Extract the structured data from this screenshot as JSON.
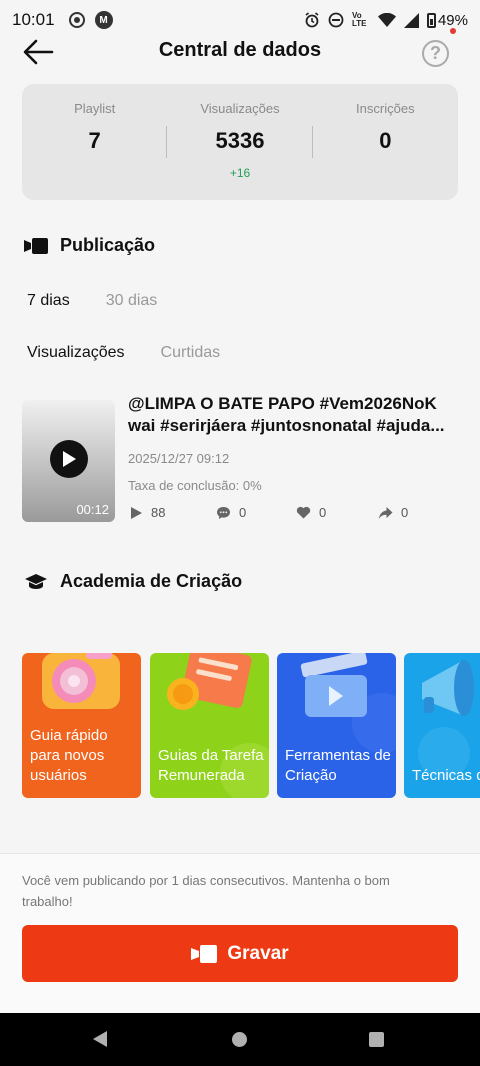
{
  "status_bar": {
    "time": "10:01",
    "battery": "49%",
    "network": "Vo LTE"
  },
  "header": {
    "title": "Central de dados",
    "help_symbol": "?"
  },
  "stats": [
    {
      "label": "Playlist",
      "value": "7",
      "delta": ""
    },
    {
      "label": "Visualizações",
      "value": "5336",
      "delta": "+16"
    },
    {
      "label": "Inscrições",
      "value": "0",
      "delta": ""
    }
  ],
  "publication": {
    "heading": "Publicação",
    "period_tabs": [
      "7 dias",
      "30 dias"
    ],
    "metric_tabs": [
      "Visualizações",
      "Curtidas"
    ],
    "video": {
      "title_line1": "@LIMPA O BATE PAPO #Vem2026NoK",
      "title_line2": "wai #serirjáera #juntosnonatal #ajuda...",
      "date": "2025/12/27 09:12",
      "completion": "Taxa de conclusão: 0%",
      "duration": "00:12",
      "plays": "88",
      "comments": "0",
      "likes": "0",
      "shares": "0"
    }
  },
  "academy": {
    "heading": "Academia de Criação",
    "cards": [
      {
        "label": "Guia rápido para novos usuários",
        "color": "#f0641e"
      },
      {
        "label": "Guias da Tarefa Remunerada",
        "color": "#8fd21a"
      },
      {
        "label": "Ferramentas de Criação",
        "color": "#2b63e8"
      },
      {
        "label": "Técnicas de Gravação",
        "color": "#1aa3e8"
      }
    ]
  },
  "bottom": {
    "streak_text": "Você vem publicando por 1 dias consecutivos. Mantenha o bom trabalho!",
    "record_label": "Gravar",
    "record_color": "#ee3a14"
  }
}
